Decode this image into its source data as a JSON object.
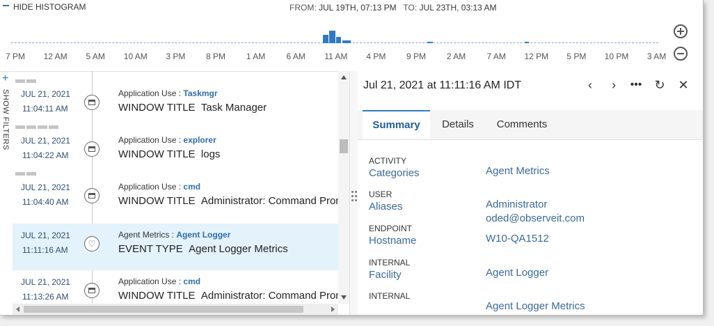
{
  "histogram": {
    "hide_label": "HIDE HISTOGRAM",
    "from_label": "FROM:",
    "from_value": "JUL 19TH, 07:13 PM",
    "to_label": "TO:",
    "to_value": "JUL 23TH, 03:13 AM",
    "tick_labels": [
      "7 PM",
      "12 AM",
      "5 AM",
      "10 AM",
      "3 PM",
      "8 PM",
      "1 AM",
      "6 AM",
      "11 AM",
      "4 PM",
      "9 PM",
      "2 AM",
      "7 AM",
      "12 PM",
      "5 PM",
      "10 PM",
      "3 AM"
    ],
    "bar_color": "#2e7bc4"
  },
  "filters": {
    "show_label": "SHOW FILTERS"
  },
  "events": [
    {
      "date": "JUL 21, 2021",
      "time": "11:04:11 AM",
      "type": "Application Use",
      "sep": " : ",
      "name": "Taskmgr",
      "main_label": "WINDOW TITLE",
      "main_value": "Task Manager",
      "icon": "window-icon"
    },
    {
      "date": "JUL 21, 2021",
      "time": "11:04:22 AM",
      "type": "Application Use",
      "sep": " : ",
      "name": "explorer",
      "main_label": "WINDOW TITLE",
      "main_value": "logs",
      "icon": "window-icon"
    },
    {
      "date": "JUL 21, 2021",
      "time": "11:04:40 AM",
      "type": "Application Use",
      "sep": " : ",
      "name": "cmd",
      "main_label": "WINDOW TITLE",
      "main_value": "Administrator: Command Prom",
      "icon": "window-icon"
    },
    {
      "date": "JUL 21, 2021",
      "time": "11:11:16 AM",
      "type": "Agent Metrics",
      "sep": " : ",
      "name": "Agent Logger",
      "main_label": "EVENT TYPE",
      "main_value": "Agent Logger Metrics",
      "icon": "heart-icon",
      "selected": true
    },
    {
      "date": "JUL 21, 2021",
      "time": "11:13:26 AM",
      "type": "Application Use",
      "sep": " : ",
      "name": "cmd",
      "main_label": "WINDOW TITLE",
      "main_value": "Administrator: Command Prom",
      "icon": "window-icon"
    }
  ],
  "detail": {
    "title": "Jul 21, 2021 at 11:11:16 AM IDT",
    "tabs": [
      "Summary",
      "Details",
      "Comments"
    ],
    "active_tab": "Summary",
    "fields": [
      {
        "key": "ACTIVITY",
        "sub": "Categories",
        "values": [
          "Agent Metrics"
        ]
      },
      {
        "key": "USER",
        "sub": "Aliases",
        "values": [
          "Administrator",
          "oded@observeit.com"
        ]
      },
      {
        "key": "ENDPOINT",
        "sub": "Hostname",
        "values": [
          "W10-QA1512"
        ]
      },
      {
        "key": "INTERNAL",
        "sub": "Facility",
        "values": [
          "Agent Logger"
        ]
      },
      {
        "key": "INTERNAL",
        "sub": "",
        "values": [
          "Agent Logger Metrics"
        ]
      }
    ]
  },
  "colors": {
    "accent": "#2e7bc4",
    "link": "#2f6fa7",
    "selected_row": "#e3f2fb"
  }
}
